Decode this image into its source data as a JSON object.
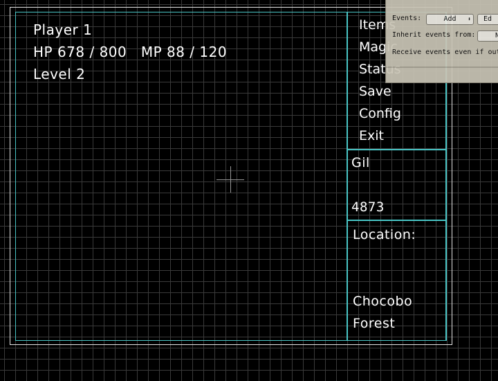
{
  "status": {
    "player": "Player 1",
    "hp_mp": "HP 678 / 800   MP 88 / 120",
    "level": "Level 2"
  },
  "menu": {
    "items": [
      "Items",
      "Magic",
      "Status",
      "Save",
      "Config",
      "Exit"
    ]
  },
  "gil": {
    "label": "Gil",
    "value": "4873"
  },
  "location": {
    "label": "Location:",
    "line1": "Chocobo",
    "line2": "Forest"
  },
  "editor": {
    "events_label": "Events:",
    "events_value": "Add",
    "edit_button": "Ed",
    "inherit_label": "Inherit events from:",
    "inherit_value": "N",
    "receive_label": "Receive events even if out"
  },
  "colors": {
    "panel_border": "#49c6c6",
    "outer_frame": "#e8e8e8",
    "grid": "#3a3a3a"
  }
}
